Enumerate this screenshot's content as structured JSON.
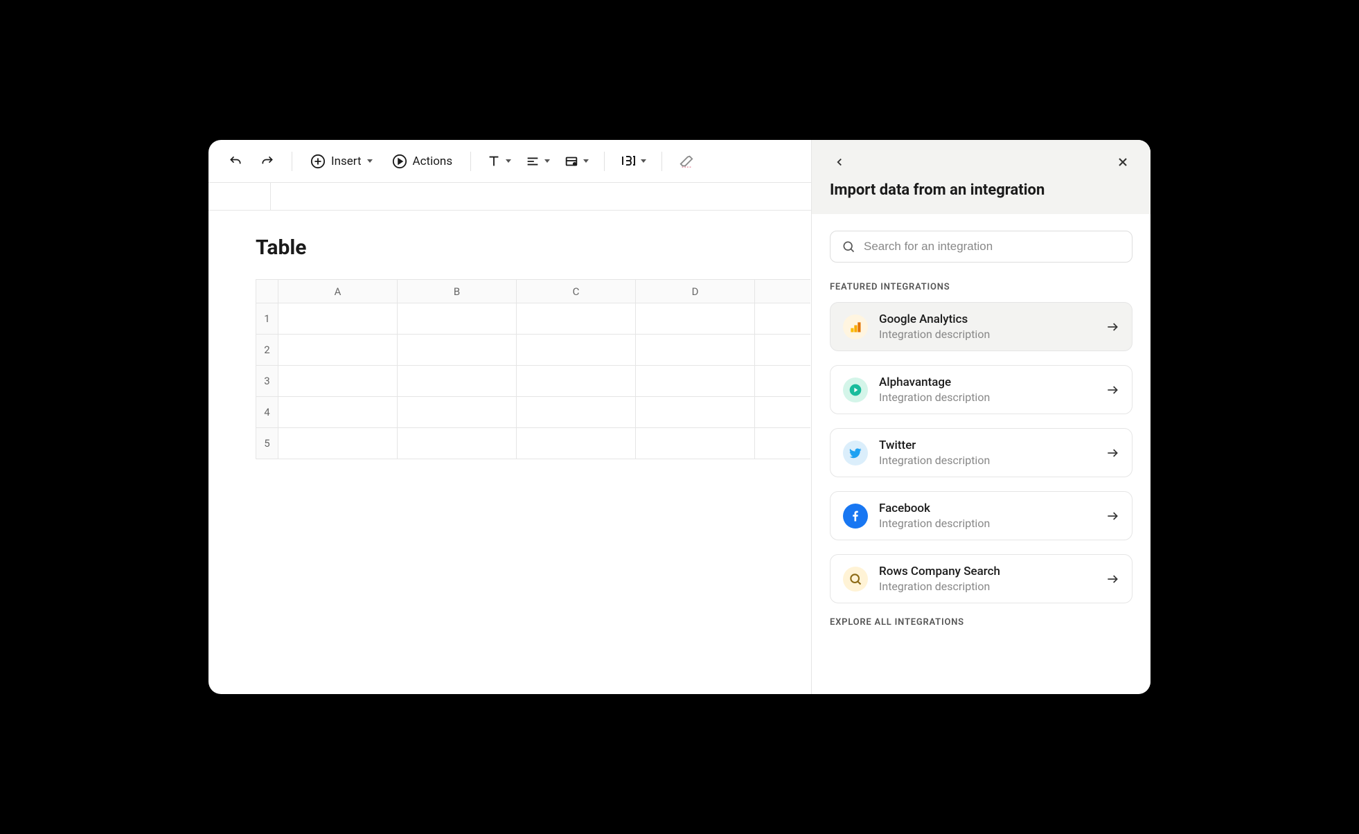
{
  "toolbar": {
    "insert_label": "Insert",
    "actions_label": "Actions"
  },
  "table": {
    "title": "Table",
    "cols": [
      "A",
      "B",
      "C",
      "D"
    ],
    "rows": [
      "1",
      "2",
      "3",
      "4",
      "5"
    ]
  },
  "panel": {
    "title": "Import data from an integration",
    "search_placeholder": "Search for an integration",
    "featured_label": "FEATURED INTEGRATIONS",
    "explore_label": "EXPLORE ALL INTEGRATIONS",
    "integrations": [
      {
        "name": "Google Analytics",
        "desc": "Integration description",
        "icon": "ga",
        "active": true
      },
      {
        "name": "Alphavantage",
        "desc": "Integration description",
        "icon": "av",
        "active": false
      },
      {
        "name": "Twitter",
        "desc": "Integration description",
        "icon": "tw",
        "active": false
      },
      {
        "name": "Facebook",
        "desc": "Integration description",
        "icon": "fb",
        "active": false
      },
      {
        "name": "Rows Company Search",
        "desc": "Integration description",
        "icon": "rows",
        "active": false
      }
    ]
  }
}
